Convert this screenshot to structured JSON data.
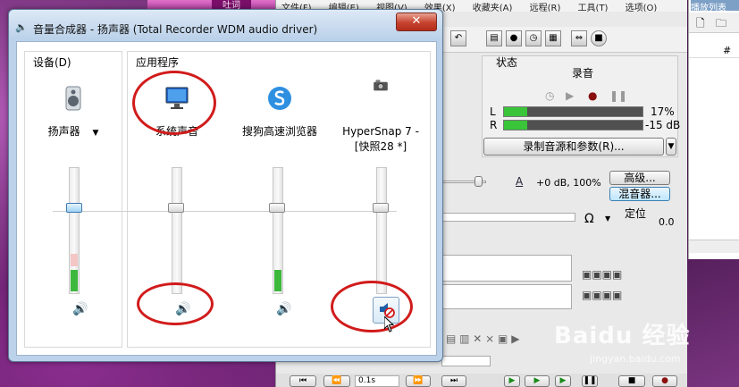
{
  "mixer": {
    "title": "音量合成器 - 扬声器 (Total Recorder WDM audio driver)",
    "close_label": "✕",
    "device_group_label": "设备(D)",
    "apps_group_label": "应用程序",
    "columns": [
      {
        "name": "扬声器",
        "dropdown": "▼",
        "icon": "speaker-device-icon",
        "volume": 0.68,
        "level": 0.18,
        "muted": false
      },
      {
        "name": "系统声音",
        "icon": "monitor-icon",
        "volume": 0.68,
        "level": 0,
        "muted": false
      },
      {
        "name": "搜狗高速浏览器",
        "icon": "sogou-browser-icon",
        "volume": 0.68,
        "level": 0.18,
        "muted": false
      },
      {
        "name": "HyperSnap 7 -",
        "name2": "[快照28 *]",
        "icon": "hypersnap-icon",
        "volume": 0.68,
        "level": 0,
        "muted": true
      }
    ]
  },
  "bgapp": {
    "menu": [
      "文件(F)",
      "编辑(E)",
      "视图(V)",
      "效果(X)",
      "收藏夹(A)",
      "远程(R)",
      "工具(T)",
      "选项(O)"
    ],
    "status_label": "状态",
    "state_value": "录音",
    "meter_L": {
      "label": "L",
      "pct": 0.17,
      "text": "17%"
    },
    "meter_R": {
      "label": "R",
      "pct": 0.17,
      "text": "-15 dB"
    },
    "source_button": "录制音源和参数(R)...",
    "gain_text": "+0 dB, 100%",
    "advanced_button": "高级...",
    "mixer_button": "混音器...",
    "position_label": "定位",
    "position_value": "0.0",
    "speed_value": "0.1s"
  },
  "playlist": {
    "title": "播放列表",
    "column_header": "#"
  },
  "desktop": {
    "tab_text": "吐词"
  },
  "watermark": {
    "text": "Baidu 经验",
    "sub": "jingyan.baidu.com"
  }
}
